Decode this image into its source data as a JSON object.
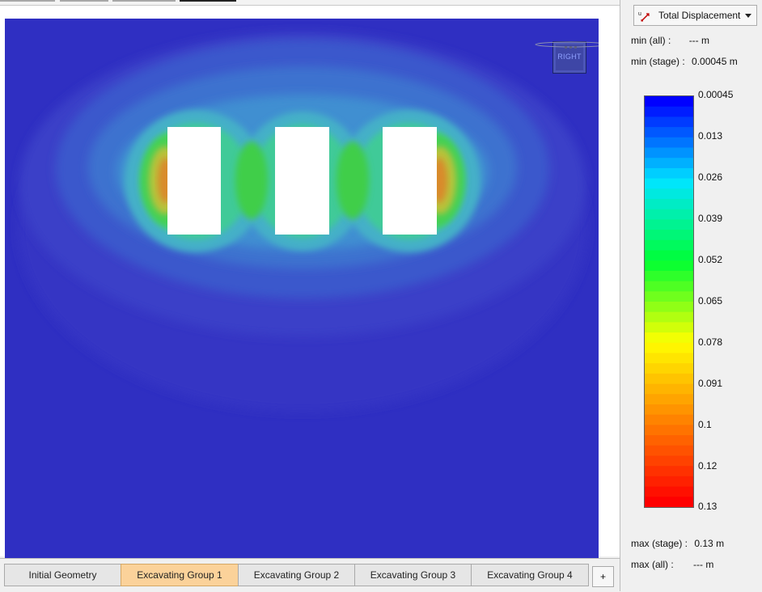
{
  "viewport": {
    "view_cube_label": "RIGHT"
  },
  "stage_tabs": [
    {
      "label": "Initial Geometry",
      "active": false
    },
    {
      "label": "Excavating Group 1",
      "active": true
    },
    {
      "label": "Excavating Group 2",
      "active": false
    },
    {
      "label": "Excavating Group 3",
      "active": false
    },
    {
      "label": "Excavating Group 4",
      "active": false
    }
  ],
  "add_stage_label": "+",
  "result_panel": {
    "result_type": "Total Displacement",
    "result_icon": "displacement-icon",
    "min_all_label": "min (all) :",
    "min_all_value": "--- m",
    "min_stage_label": "min (stage) :",
    "min_stage_value": "0.00045 m",
    "max_stage_label": "max (stage) :",
    "max_stage_value": "0.13 m",
    "max_all_label": "max (all) :",
    "max_all_value": "--- m",
    "legend_ticks": [
      "0.00045",
      "0.013",
      "0.026",
      "0.039",
      "0.052",
      "0.065",
      "0.078",
      "0.091",
      "0.1",
      "0.12",
      "0.13"
    ],
    "color_scale": [
      "#0000ff",
      "#00e5ff",
      "#00ff33",
      "#ffff00",
      "#ff8000",
      "#ff0000"
    ]
  }
}
